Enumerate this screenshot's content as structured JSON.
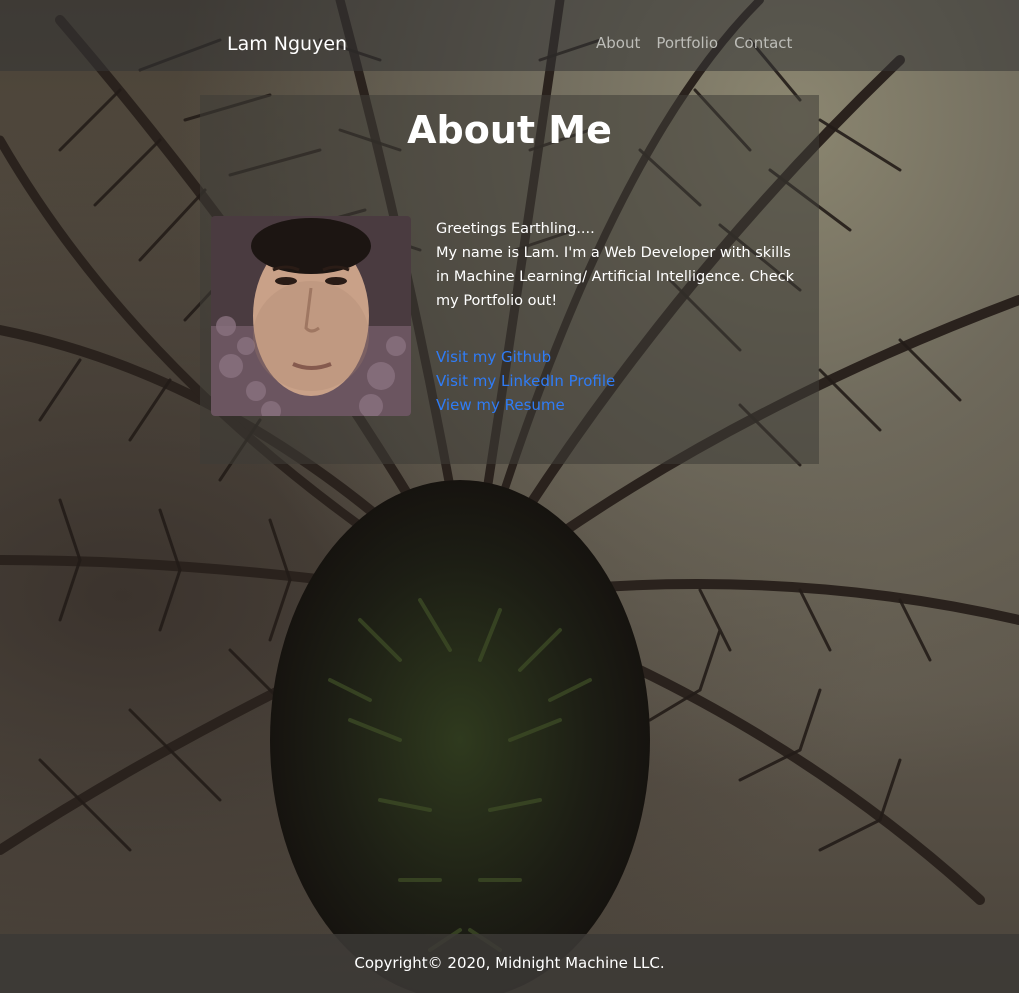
{
  "nav": {
    "brand": "Lam Nguyen",
    "links": [
      "About",
      "Portfolio",
      "Contact"
    ]
  },
  "main": {
    "title": "About Me",
    "greeting": "Greetings Earthling....",
    "bio": "My name is Lam. I'm a Web Developer with skills in Machine Learning/ Artificial Intelligence. Check my Portfolio out!",
    "links": {
      "github": "Visit my Github",
      "linkedin": "Visit my LinkedIn Profile",
      "resume": "View my Resume"
    }
  },
  "footer": {
    "copyright": "Copyright© 2020, Midnight Machine LLC."
  },
  "colors": {
    "link": "#2f7cf6",
    "text": "#ffffff",
    "nav_link": "#bdbdb8"
  }
}
